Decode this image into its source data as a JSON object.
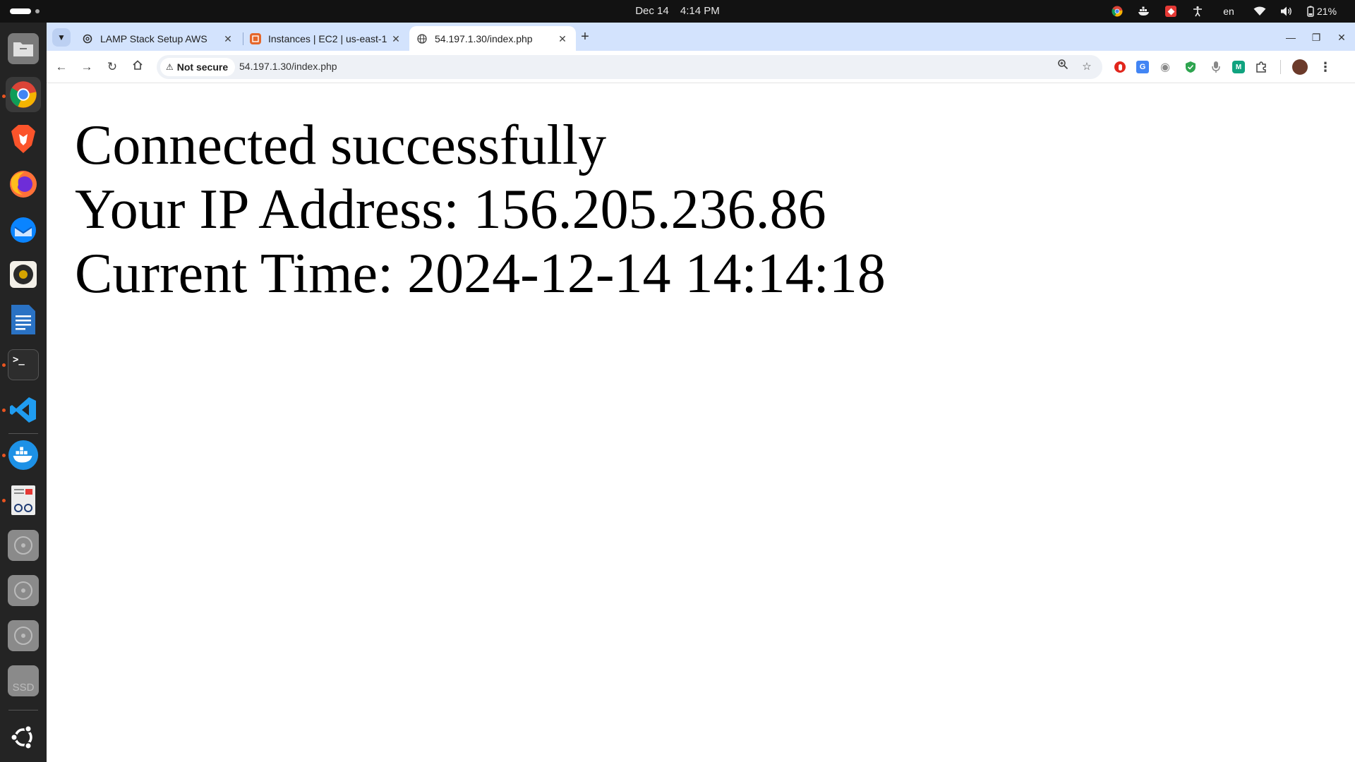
{
  "system_bar": {
    "date": "Dec 14",
    "time": "4:14 PM",
    "language": "en",
    "battery": "21%"
  },
  "dock": {
    "items": [
      {
        "name": "files",
        "icon": "folder-icon",
        "color": "#7a7a7a"
      },
      {
        "name": "google-chrome",
        "icon": "chrome-icon",
        "color": "#1a73e8",
        "active": true
      },
      {
        "name": "brave",
        "icon": "brave-icon",
        "color": "#fb542b"
      },
      {
        "name": "firefox",
        "icon": "firefox-icon",
        "color": "#ff7139"
      },
      {
        "name": "thunderbird",
        "icon": "thunderbird-icon",
        "color": "#0a84ff"
      },
      {
        "name": "rhythmbox",
        "icon": "speaker-icon",
        "color": "#d6a400"
      },
      {
        "name": "libreoffice-writer",
        "icon": "writer-icon",
        "color": "#2a72c4"
      },
      {
        "name": "terminal",
        "icon": "terminal-icon",
        "color": "#2d2d2d"
      },
      {
        "name": "vscode",
        "icon": "vscode-icon",
        "color": "#0078d4"
      },
      {
        "name": "docker",
        "icon": "docker-icon",
        "color": "#1d91e6"
      },
      {
        "name": "document-viewer",
        "icon": "document-icon",
        "color": "#d9d9d9"
      },
      {
        "name": "disk-1",
        "icon": "disk-icon",
        "color": "#8a8a8a"
      },
      {
        "name": "disk-2",
        "icon": "disk-icon",
        "color": "#8a8a8a"
      },
      {
        "name": "disk-3",
        "icon": "disk-icon",
        "color": "#8a8a8a"
      },
      {
        "name": "ssd",
        "icon": "ssd-icon",
        "color": "#8a8a8a",
        "label": "SSD"
      },
      {
        "name": "show-apps",
        "icon": "ubuntu-icon",
        "color": "#242424"
      }
    ]
  },
  "browser": {
    "tabs": [
      {
        "title": "LAMP Stack Setup AWS",
        "favicon": "openai-icon",
        "active": false
      },
      {
        "title": "Instances | EC2 | us-east-1",
        "favicon": "aws-icon",
        "active": false
      },
      {
        "title": "54.197.1.30/index.php",
        "favicon": "globe-icon",
        "active": true
      }
    ],
    "security_label": "Not secure",
    "url": "54.197.1.30/index.php"
  },
  "page": {
    "line1": "Connected successfully",
    "line2": "Your IP Address: 156.205.236.86",
    "line3": "Current Time: 2024-12-14 14:14:18"
  }
}
